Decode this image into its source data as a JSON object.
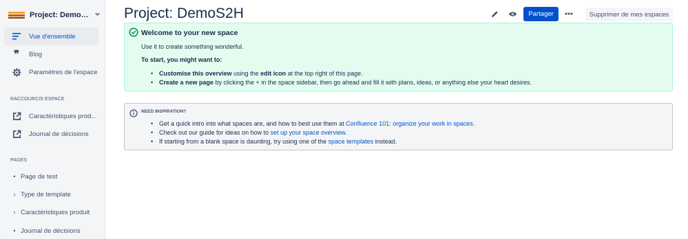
{
  "sidebar": {
    "space_name": "Project: DemoS...",
    "nav": [
      {
        "label": "Vue d'ensemble",
        "icon": "overview-icon",
        "active": true
      },
      {
        "label": "Blog",
        "icon": "quote-icon",
        "active": false
      },
      {
        "label": "Paramètres de l'espace",
        "icon": "gear-icon",
        "active": false
      }
    ],
    "shortcuts_title": "RACCOURCIS ESPACE",
    "shortcuts": [
      {
        "label": "Caractéristiques prod..."
      },
      {
        "label": "Journal de décisions"
      }
    ],
    "pages_title": "PAGES",
    "pages": [
      {
        "label": "Page de test",
        "marker": "•"
      },
      {
        "label": "Type de template",
        "marker": "›"
      },
      {
        "label": "Caractéristiques produit",
        "marker": "›"
      },
      {
        "label": "Journal de décisions",
        "marker": "•"
      }
    ]
  },
  "header": {
    "title": "Project: DemoS2H",
    "share_label": "Partager",
    "remove_label": "Supprimer de mes espaces"
  },
  "welcome": {
    "title": "Welcome to your new space",
    "text": "Use it to create something wonderful.",
    "start": "To start, you might want to:",
    "b1_strong1": "Customise this overview",
    "b1_text1": " using the ",
    "b1_strong2": "edit icon",
    "b1_text2": " at the top right of this page.",
    "b2_strong": "Create a new page",
    "b2_text": " by clicking the + in the space sidebar, then go ahead and fill it with plans, ideas, or anything else your heart desires."
  },
  "inspiration": {
    "title": "NEED INSPIRATION?",
    "i1_text": "Get a quick intro into what spaces are, and how to best use them at ",
    "i1_link": "Confluence 101: organize your work in spaces",
    "i1_end": ".",
    "i2_text": "Check out our guide for ideas on how to ",
    "i2_link": "set up your space overview",
    "i2_end": ".",
    "i3_text": "If starting from a blank space is daunting, try using one of the ",
    "i3_link": "space templates",
    "i3_end": " instead."
  },
  "colors": {
    "primary": "#0052cc",
    "success_bg": "#e3fcef",
    "success_icon": "#00875a",
    "info_bg": "#f4f5f7"
  }
}
